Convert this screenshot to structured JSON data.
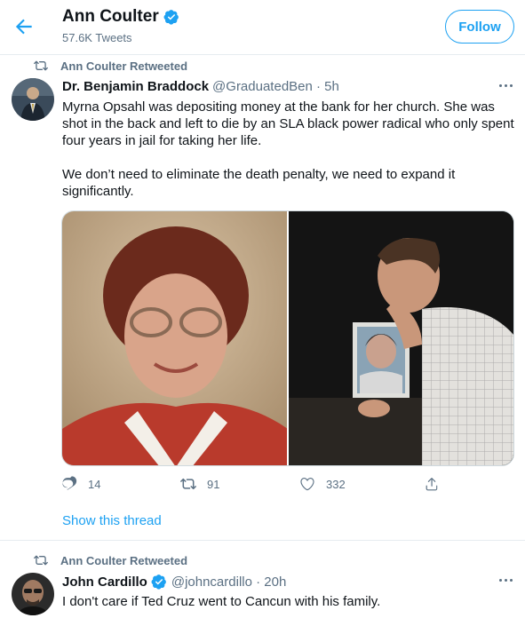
{
  "header": {
    "title": "Ann Coulter",
    "subtitle": "57.6K Tweets",
    "follow_label": "Follow"
  },
  "tweets": [
    {
      "retweet_label": "Ann Coulter Retweeted",
      "name": "Dr. Benjamin Braddock",
      "handle": "@GraduatedBen · 5h",
      "text": "Myrna Opsahl was depositing money at the bank for her church. She was shot in the back and left to die by an SLA black power radical who only spent four years in jail for taking her life.\n\nWe don’t need to eliminate the death penalty, we need to expand it significantly.",
      "replies": "14",
      "retweets": "91",
      "likes": "332",
      "show_thread": "Show this thread"
    },
    {
      "retweet_label": "Ann Coulter Retweeted",
      "name": "John Cardillo",
      "handle": "@johncardillo · 20h",
      "text": "I don't care if Ted Cruz went to Cancun with his family."
    }
  ],
  "colors": {
    "accent": "#1da1f2",
    "muted": "#5b7083",
    "divider": "#e6ecf0"
  },
  "icons": {
    "back": "arrow-left-icon",
    "verified": "verified-badge-icon",
    "retweet": "retweet-icon",
    "reply": "reply-icon",
    "like": "heart-icon",
    "share": "share-icon",
    "more": "more-icon"
  }
}
